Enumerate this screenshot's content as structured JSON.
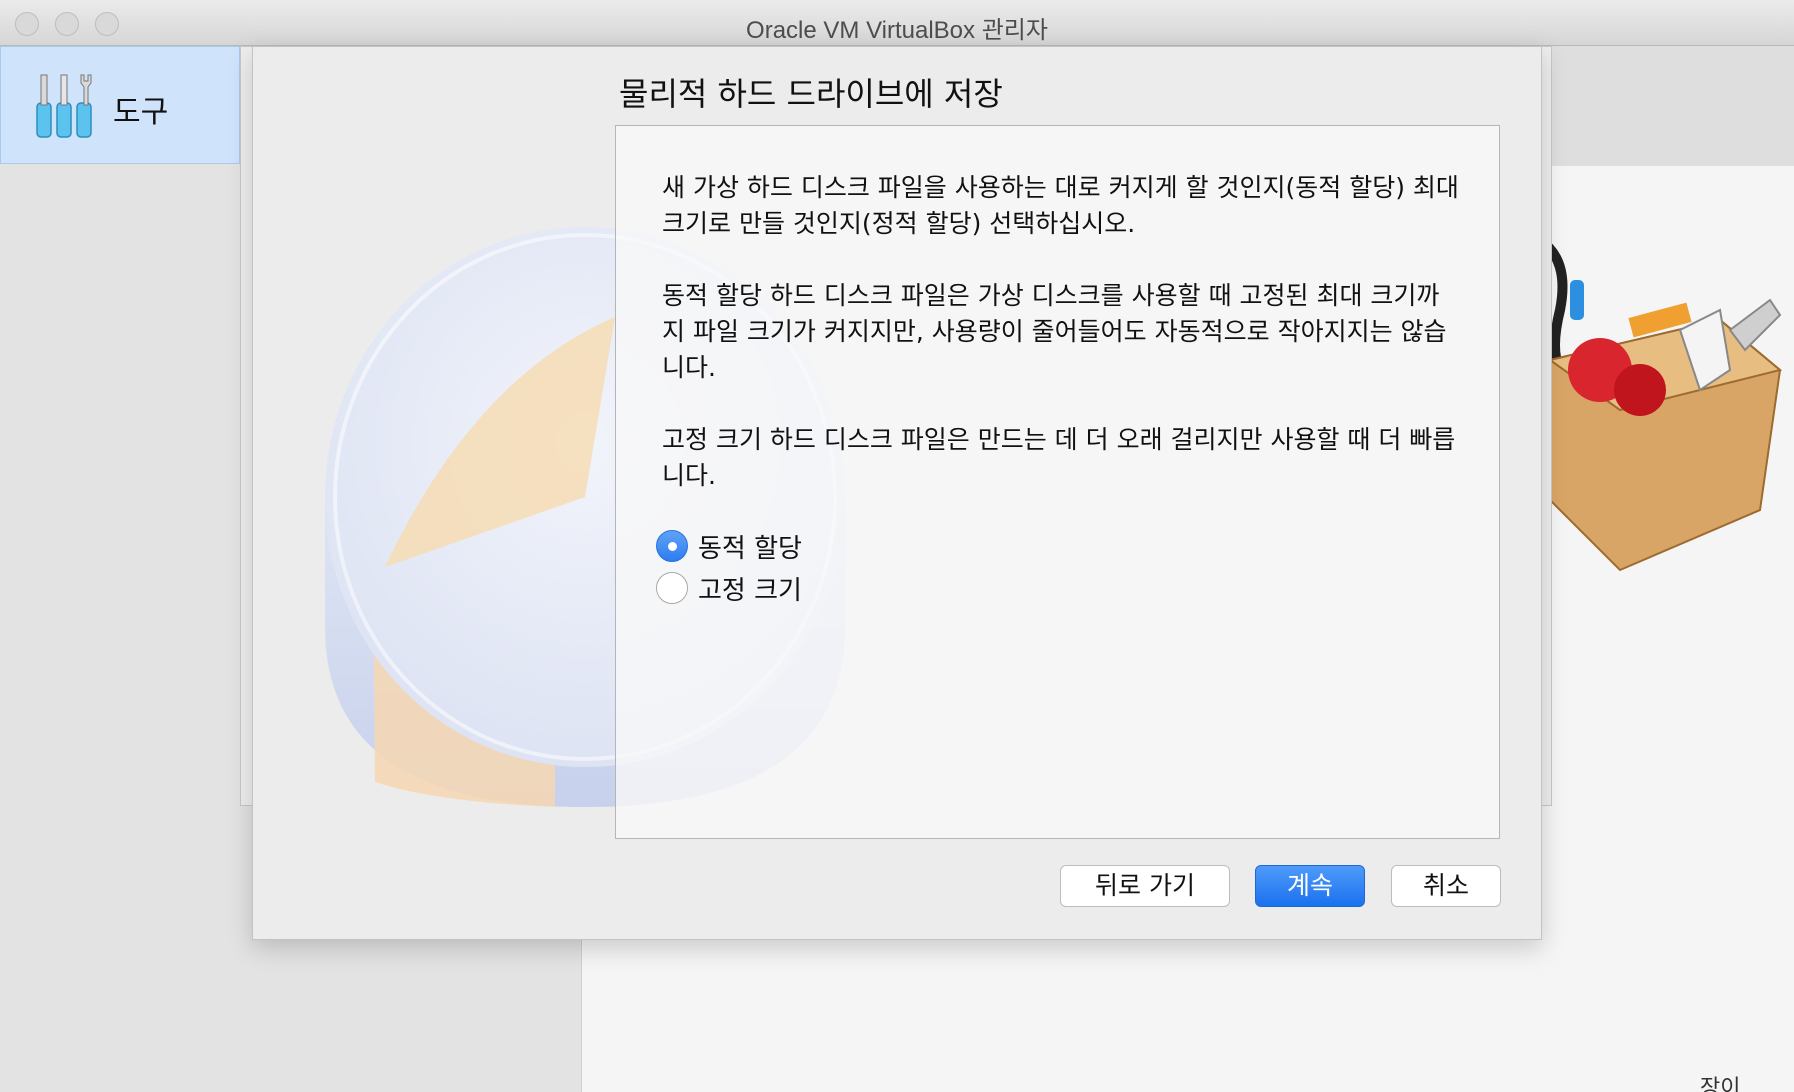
{
  "window": {
    "title": "Oracle VM VirtualBox 관리자"
  },
  "sidebar": {
    "tools_label": "도구"
  },
  "dialog": {
    "title": "물리적 하드 드라이브에 저장",
    "paragraphs": [
      "새 가상 하드 디스크 파일을 사용하는 대로 커지게 할 것인지(동적 할당) 최대 크기로 만들 것인지(정적 할당) 선택하십시오.",
      "동적 할당 하드 디스크 파일은 가상 디스크를 사용할 때 고정된 최대 크기까지 파일 크기가 커지지만, 사용량이 줄어들어도 자동적으로 작아지지는 않습니다.",
      "고정 크기 하드 디스크 파일은 만드는 데 더 오래 걸리지만 사용할 때 더 빠릅니다."
    ],
    "options": [
      {
        "label": "동적 할당",
        "selected": true
      },
      {
        "label": "고정 크기",
        "selected": false
      }
    ],
    "buttons": {
      "back": "뒤로 가기",
      "continue": "계속",
      "cancel": "취소"
    }
  },
  "background": {
    "partial_text": "장이 ."
  },
  "colors": {
    "accent": "#2d7df1",
    "sidebar_selected": "#cfe3fb"
  }
}
